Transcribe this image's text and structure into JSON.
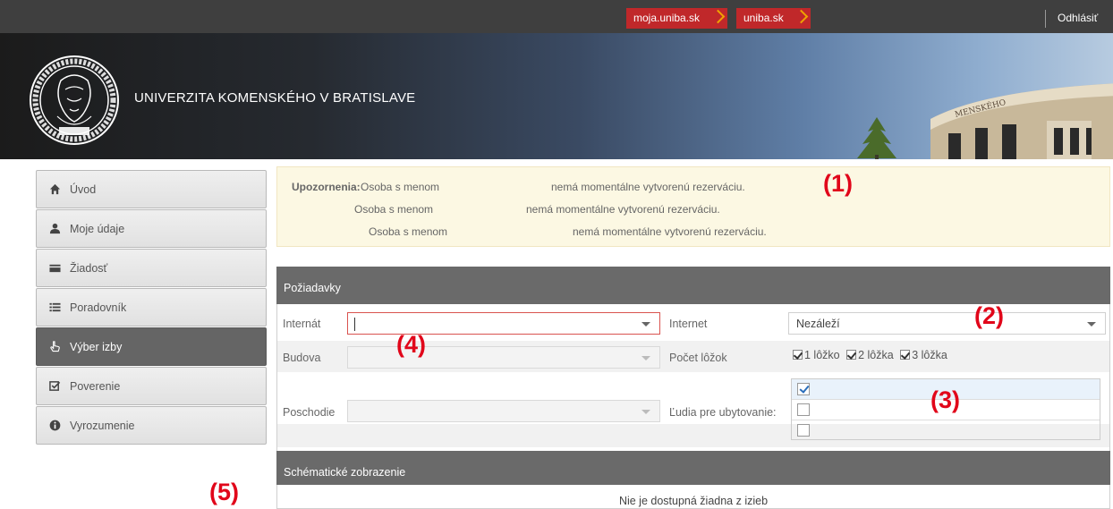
{
  "topbar": {
    "links": [
      {
        "label": "moja.uniba.sk"
      },
      {
        "label": "uniba.sk"
      }
    ],
    "logout_label": "Odhlásiť",
    "accent_color": "#c0282a"
  },
  "banner": {
    "university_name": "UNIVERZITA KOMENSKÉHO V BRATISLAVE",
    "seal_icon": "university-seal-icon"
  },
  "sidebar": {
    "items": [
      {
        "label": "Úvod",
        "icon": "home-icon"
      },
      {
        "label": "Moje údaje",
        "icon": "user-icon"
      },
      {
        "label": "Žiadosť",
        "icon": "card-icon"
      },
      {
        "label": "Poradovník",
        "icon": "list-icon"
      },
      {
        "label": "Výber izby",
        "icon": "hand-pointer-icon",
        "active": true
      },
      {
        "label": "Poverenie",
        "icon": "check-square-icon"
      },
      {
        "label": "Vyrozumenie",
        "icon": "info-circle-icon"
      }
    ]
  },
  "alert": {
    "label": "Upozornenia:",
    "lines": [
      {
        "name": "Osoba s menom",
        "message": "nemá momentálne vytvorenú rezerváciu."
      },
      {
        "name": "Osoba s menom",
        "message": "nemá momentálne vytvorenú rezerváciu."
      },
      {
        "name": "Osoba s menom",
        "message": "nemá momentálne vytvorenú rezerváciu."
      }
    ]
  },
  "requests": {
    "title": "Požiadavky",
    "internat": {
      "label": "Internát",
      "value": ""
    },
    "internet": {
      "label": "Internet",
      "value": "Nezáleží"
    },
    "budova": {
      "label": "Budova",
      "value": ""
    },
    "beds": {
      "label": "Počet lôžok",
      "options": [
        {
          "label": "1 lôžko",
          "checked": true
        },
        {
          "label": "2 lôžka",
          "checked": true
        },
        {
          "label": "3 lôžka",
          "checked": true
        }
      ]
    },
    "poschodie": {
      "label": "Poschodie",
      "value": ""
    },
    "people": {
      "label": "Ľudia pre ubytovanie:",
      "rows": [
        {
          "checked": true
        },
        {
          "checked": false
        },
        {
          "checked": false
        }
      ]
    }
  },
  "schema": {
    "title": "Schématické zobrazenie",
    "empty_text": "Nie je dostupná žiadna z izieb"
  },
  "markers": [
    "(1)",
    "(2)",
    "(3)",
    "(4)",
    "(5)"
  ],
  "marker_color": "#e1061a"
}
